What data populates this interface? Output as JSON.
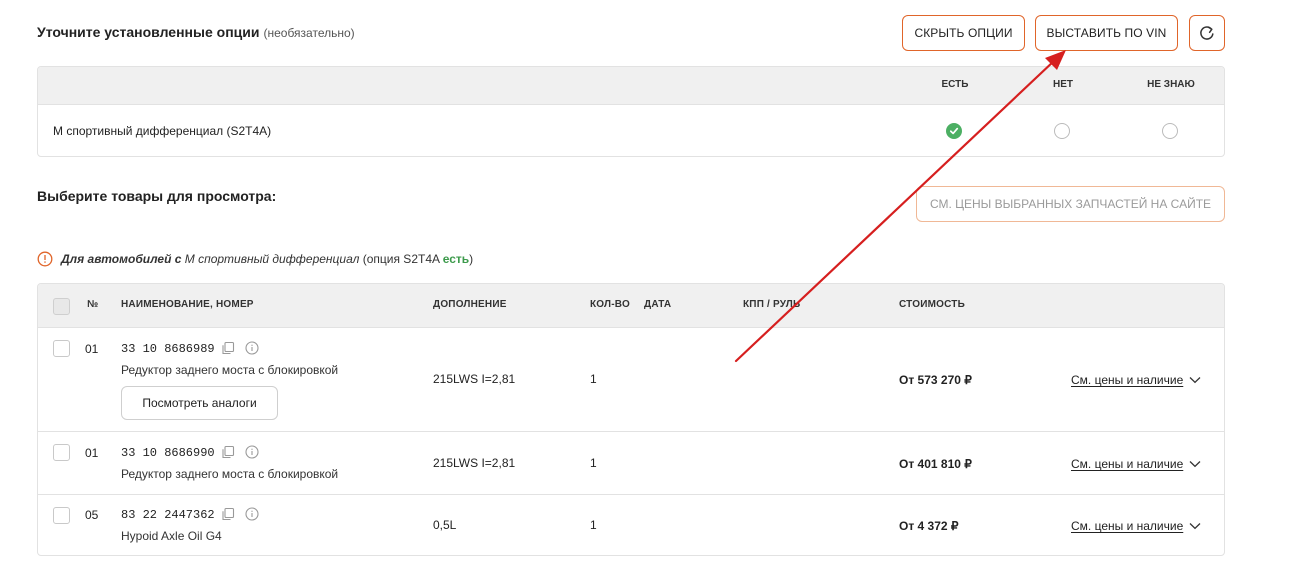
{
  "header": {
    "title": "Уточните установленные опции",
    "title_note": "(необязательно)",
    "hide_options_label": "СКРЫТЬ ОПЦИИ",
    "set_by_vin_label": "ВЫСТАВИТЬ ПО VIN",
    "reset_icon": "refresh-icon"
  },
  "options": {
    "columns": [
      "ЕСТЬ",
      "НЕТ",
      "НЕ ЗНАЮ"
    ],
    "rows": [
      {
        "label": "M спортивный дифференциал (S2T4A)",
        "selected": "ЕСТЬ"
      }
    ]
  },
  "products": {
    "title": "Выберите товары для просмотра:",
    "see_prices_label": "СМ. ЦЕНЫ ВЫБРАННЫХ ЗАПЧАСТЕЙ НА САЙТЕ",
    "note_prefix": "Для автомобилей с",
    "note_option": "M спортивный дифференциал",
    "note_code": "(опция S2T4A",
    "note_status": "есть",
    "note_close": ")"
  },
  "table": {
    "headers": {
      "num": "№",
      "name": "НАИМЕНОВАНИЕ, НОМЕР",
      "extra": "ДОПОЛНЕНИЕ",
      "qty": "КОЛ-ВО",
      "date": "ДАТА",
      "gearbox": "КПП / РУЛЬ",
      "price": "СТОИМОСТЬ"
    },
    "rows": [
      {
        "num": "01",
        "part_no": "33 10 8686989",
        "name": "Редуктор заднего моста с блокировкой",
        "extra": "215LWS I=2,81",
        "qty": "1",
        "price": "От 573 270 ₽",
        "link": "См. цены и наличие",
        "analog": "Посмотреть аналоги"
      },
      {
        "num": "01",
        "part_no": "33 10 8686990",
        "name": "Редуктор заднего моста с блокировкой",
        "extra": "215LWS I=2,81",
        "qty": "1",
        "price": "От 401 810 ₽",
        "link": "См. цены и наличие"
      },
      {
        "num": "05",
        "part_no": "83 22 2447362",
        "name": "Hypoid Axle Oil G4",
        "extra": "0,5L",
        "qty": "1",
        "price": "От 4 372 ₽",
        "link": "См. цены и наличие"
      }
    ]
  },
  "colors": {
    "accent": "#e0652a",
    "check_green": "#4caf63",
    "annotation_red": "#d61f1f"
  }
}
